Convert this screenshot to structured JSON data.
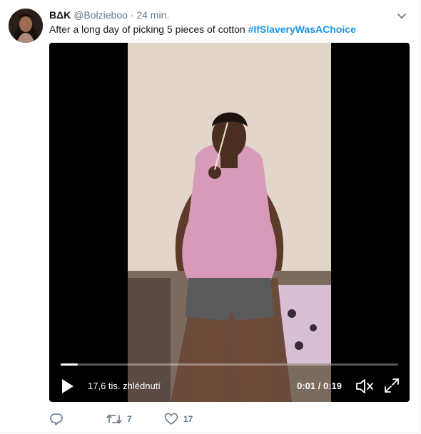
{
  "tweet": {
    "author_name": "BΔK",
    "handle": "@Bolzieboo",
    "separator": "·",
    "time": "24 min.",
    "text": "After a long day of picking 5 pieces of cotton ",
    "hashtag": "#IfSlaveryWasAChoice"
  },
  "video": {
    "views": "17,6 tis. zhlédnutí",
    "timecode": "0:01 / 0:19",
    "progress": 0.05
  },
  "actions": {
    "reply_count": "",
    "retweet_count": "7",
    "like_count": "17"
  },
  "icons": {
    "chevron": "chevron-down-icon",
    "play": "play-icon",
    "mute": "mute-icon",
    "fullscreen": "fullscreen-icon",
    "reply": "reply-icon",
    "retweet": "retweet-icon",
    "like": "heart-icon"
  },
  "colors": {
    "hashtag": "#1b95e0",
    "secondary_text": "#657786",
    "video_background": "#000000"
  }
}
